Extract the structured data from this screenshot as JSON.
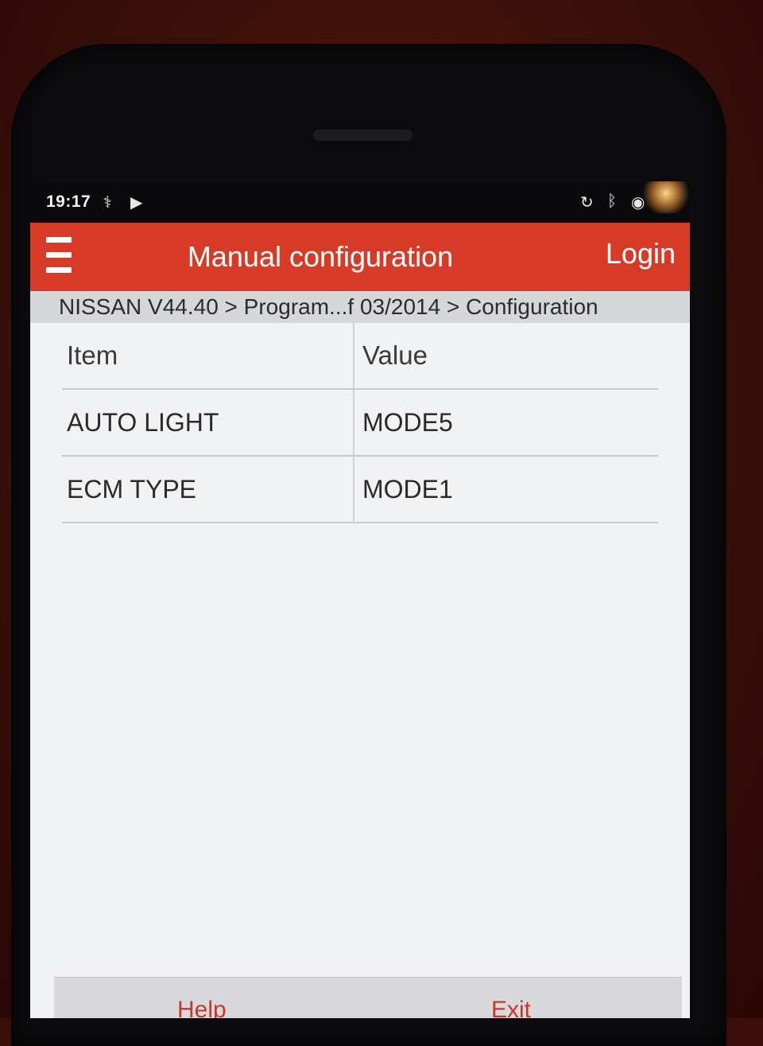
{
  "status_bar": {
    "time": "19:17",
    "left_icons": [
      "usb-debug-icon",
      "diagnostic-app-icon"
    ],
    "right_icons": [
      "sync-icon",
      "bluetooth-icon",
      "location-icon",
      "battery-icon"
    ]
  },
  "title_bar": {
    "title": "Manual configuration",
    "login_label": "Login",
    "background_color": "#d83a28"
  },
  "breadcrumb": {
    "text": "NISSAN V44.40 > Program...f 03/2014 > Configuration"
  },
  "table": {
    "headers": {
      "item": "Item",
      "value": "Value"
    },
    "rows": [
      {
        "item": "AUTO LIGHT",
        "value": "MODE5"
      },
      {
        "item": "ECM TYPE",
        "value": "MODE1"
      }
    ]
  },
  "bottom_bar": {
    "help_label": "Help",
    "exit_label": "Exit"
  }
}
